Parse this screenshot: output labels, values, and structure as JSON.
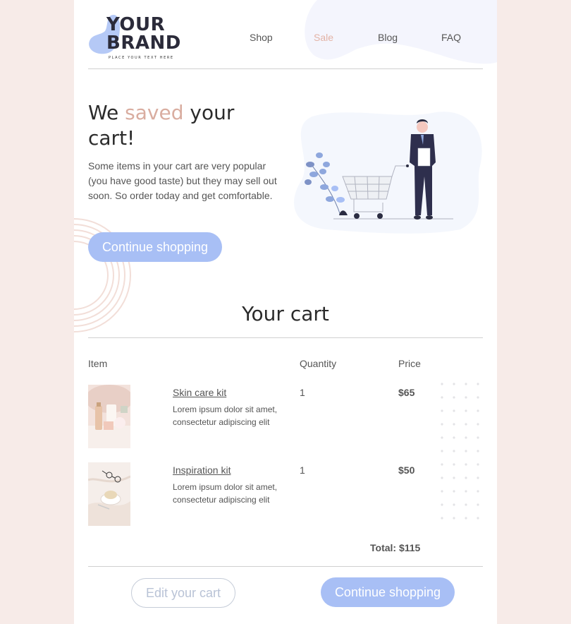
{
  "brand": {
    "name_line1": "YOUR",
    "name_line2": "BRAND",
    "tagline": "PLACE YOUR TEXT HERE"
  },
  "nav": {
    "items": [
      {
        "label": "Shop"
      },
      {
        "label": "Sale",
        "highlighted": true
      },
      {
        "label": "Blog"
      },
      {
        "label": "FAQ"
      }
    ]
  },
  "hero": {
    "title_part1": "We ",
    "title_accent": "saved",
    "title_part2": " your cart!",
    "body": "Some items in your cart are very popular (you have good taste) but they may sell out soon. So order today and get comfortable.",
    "cta_label": "Continue shopping",
    "illustration_icon": "shopping-cart-person-illustration"
  },
  "cart": {
    "title": "Your cart",
    "columns": [
      "Item",
      "Quantity",
      "Price"
    ],
    "items": [
      {
        "name": "Skin care kit",
        "description": "Lorem ipsum dolor sit amet, consectetur adipiscing elit",
        "quantity": "1",
        "price": "$65",
        "image_icon": "skin-care-photo"
      },
      {
        "name": "Inspiration kit",
        "description": "Lorem ipsum dolor sit amet, consectetur adipiscing elit",
        "quantity": "1",
        "price": "$50",
        "image_icon": "coffee-glasses-photo"
      }
    ],
    "total": "Total: $115",
    "edit_label": "Edit your cart",
    "continue_label": "Continue shopping"
  },
  "colors": {
    "accent_blue": "#a8bff5",
    "accent_pink": "#d9ada0",
    "background": "#f7ebe8",
    "text": "#555555"
  }
}
